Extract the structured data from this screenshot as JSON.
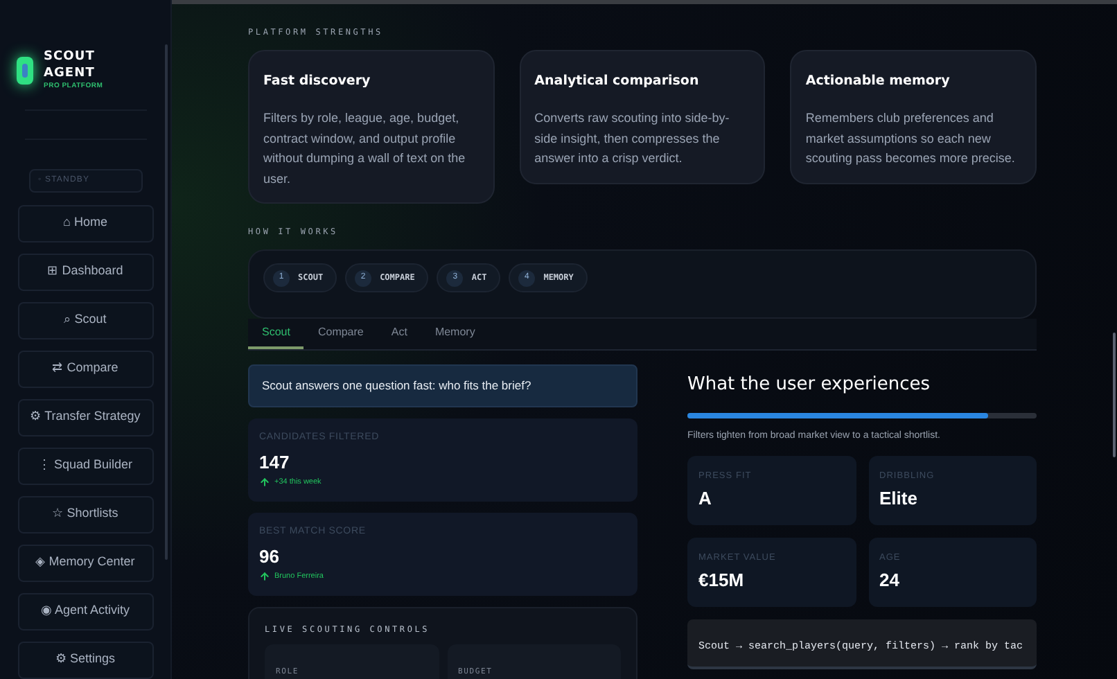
{
  "brand": {
    "name_line_1": "SCOUT",
    "name_line_2": "AGENT",
    "tagline": "PRO PLATFORM"
  },
  "status": "◦ STANDBY",
  "nav": [
    {
      "label": "⌂ Home",
      "selected": false
    },
    {
      "label": "⊞ Dashboard",
      "selected": false
    },
    {
      "label": "⌕ Scout",
      "selected": false
    },
    {
      "label": "⇄ Compare",
      "selected": false
    },
    {
      "label": "⚙ Transfer Strategy",
      "selected": false
    },
    {
      "label": "⋮ Squad Builder",
      "selected": false
    },
    {
      "label": "☆ Shortlists",
      "selected": false
    },
    {
      "label": "◈ Memory Center",
      "selected": false
    },
    {
      "label": "◉ Agent Activity",
      "selected": false
    },
    {
      "label": "⚙ Settings",
      "selected": false
    }
  ],
  "strengths": {
    "heading": "PLATFORM STRENGTHS",
    "cards": [
      {
        "title": "Fast discovery",
        "text": "Filters by role, league, age, budget, contract window, and output profile without dumping a wall of text on the user."
      },
      {
        "title": "Analytical comparison",
        "text": "Converts raw scouting into side-by-side insight, then compresses the answer into a crisp verdict."
      },
      {
        "title": "Actionable memory",
        "text": "Remembers club preferences and market assumptions so each new scouting pass becomes more precise."
      }
    ]
  },
  "how_it_works": {
    "heading": "HOW IT WORKS",
    "steps": [
      {
        "number": "1",
        "label": "SCOUT"
      },
      {
        "number": "2",
        "label": "COMPARE"
      },
      {
        "number": "3",
        "label": "ACT"
      },
      {
        "number": "4",
        "label": "MEMORY"
      }
    ]
  },
  "tabs": [
    {
      "label": "Scout",
      "selected": true
    },
    {
      "label": "Compare",
      "selected": false
    },
    {
      "label": "Act",
      "selected": false
    },
    {
      "label": "Memory",
      "selected": false
    }
  ],
  "banner": "Scout answers one question fast: who fits the brief?",
  "stats": [
    {
      "label": "CANDIDATES FILTERED",
      "value": "147",
      "trend": "+34 this week"
    },
    {
      "label": "BEST MATCH SCORE",
      "value": "96",
      "trend": "Bruno Ferreira"
    }
  ],
  "controls": {
    "heading": "LIVE SCOUTING CONTROLS",
    "fields": [
      {
        "label": "ROLE"
      },
      {
        "label": "BUDGET"
      }
    ]
  },
  "experience": {
    "heading": "What the user experiences",
    "progress": {
      "level": 0.86
    },
    "caption": "Filters tighten from broad market view to a tactical shortlist.",
    "tiles": [
      {
        "label": "PRESS FIT",
        "value": "A"
      },
      {
        "label": "DRIBBLING",
        "value": "Elite"
      },
      {
        "label": "MARKET VALUE",
        "value": "€15M"
      },
      {
        "label": "AGE",
        "value": "24"
      }
    ],
    "code": "Scout → search_players(query, filters) → rank by tac"
  }
}
